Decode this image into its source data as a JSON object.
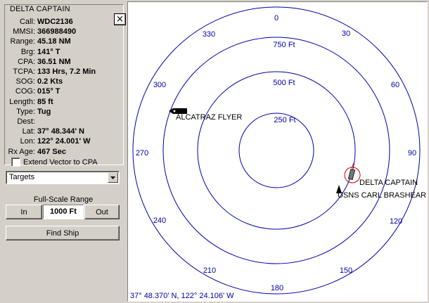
{
  "panel": {
    "title": "DELTA CAPTAIN",
    "close_label": "×",
    "info": [
      {
        "label": "Call:",
        "value": "WDC2136"
      },
      {
        "label": "MMSI:",
        "value": "366988490"
      },
      {
        "label": "Range:",
        "value": "45.18 NM"
      },
      {
        "label": "Brg:",
        "value": "141° T"
      },
      {
        "label": "CPA:",
        "value": "36.51 NM"
      },
      {
        "label": "TCPA:",
        "value": "133 Hrs, 7.2 Min"
      },
      {
        "label": "SOG:",
        "value": "0.2 Kts"
      },
      {
        "label": "COG:",
        "value": "015° T"
      },
      {
        "label": "Length:",
        "value": "85 ft"
      },
      {
        "label": "Type:",
        "value": "Tug"
      },
      {
        "label": "Dest:",
        "value": ""
      },
      {
        "label": "Lat:",
        "value": "37° 48.344' N"
      },
      {
        "label": "Lon:",
        "value": "122° 24.001' W"
      },
      {
        "label": "Rx Age:",
        "value": "467 Sec"
      }
    ],
    "extend_vector_label": "Extend Vector to CPA",
    "extend_vector_checked": false
  },
  "filter_select": {
    "value": "Targets"
  },
  "range": {
    "label": "Full-Scale Range",
    "in_label": "In",
    "value": "1000 Ft",
    "out_label": "Out"
  },
  "find_ship_label": "Find Ship",
  "radar": {
    "bearings": [
      "0",
      "30",
      "60",
      "90",
      "120",
      "150",
      "180",
      "210",
      "240",
      "270",
      "300",
      "330"
    ],
    "ring_labels": [
      "250 Ft",
      "500 Ft",
      "750 Ft"
    ],
    "coordinate_readout": "37° 48.370' N, 122° 24.106' W",
    "ring_color": "#0000aa",
    "targets": [
      {
        "name": "ALCATRAZ FLYER"
      },
      {
        "name": "DELTA CAPTAIN",
        "selected": true
      },
      {
        "name": "USNS CARL BRASHEAR"
      }
    ]
  }
}
